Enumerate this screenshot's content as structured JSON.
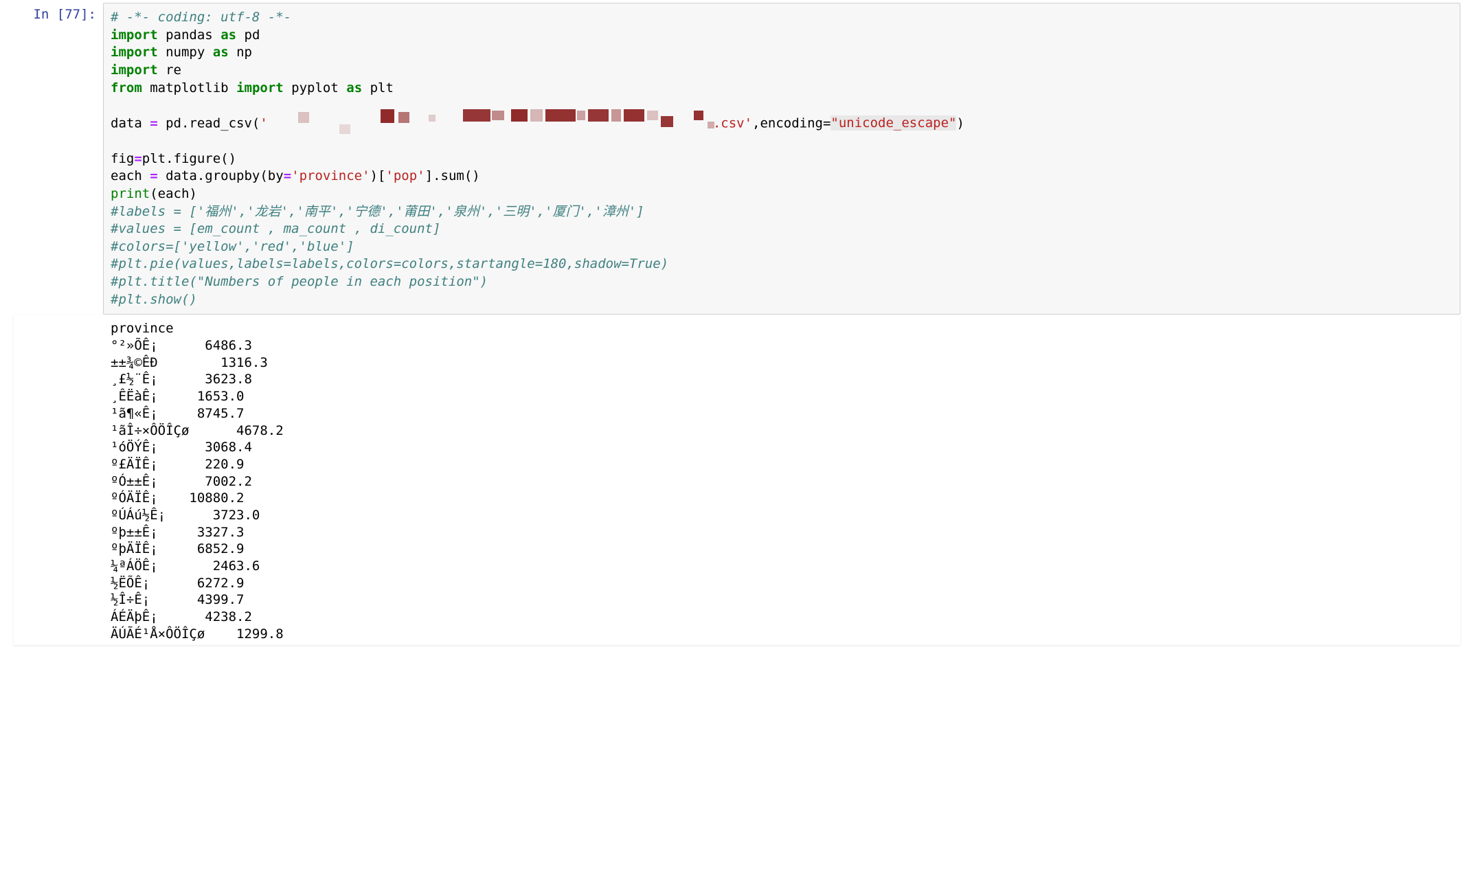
{
  "prompt": "In [77]:",
  "code": {
    "line1_comment": "# -*- coding: utf-8 -*-",
    "import_kw": "import",
    "from_kw": "from",
    "as_kw": "as",
    "pandas": "pandas",
    "pd": "pd",
    "numpy": "numpy",
    "np": "np",
    "re": "re",
    "matplotlib": "matplotlib",
    "pyplot": "pyplot",
    "plt": "plt",
    "data_var": "data ",
    "eq": "=",
    "readcsv_call": " pd.read_csv(",
    "str_start": "'",
    "csv_tail": ".csv'",
    "encoding_arg": ",encoding=",
    "encoding_val": "\"unicode_escape\"",
    "close_paren": ")",
    "fig_line_a": "fig",
    "fig_line_b": "plt.figure()",
    "each_line_a": "each ",
    "each_line_b": " data.groupby(by",
    "each_line_eq2": "=",
    "str_province": "'province'",
    "each_line_c": ")[",
    "str_pop": "'pop'",
    "each_line_d": "].sum()",
    "print_name": "print",
    "print_arg": "(each)",
    "c_labels": "#labels = ['福州','龙岩','南平','宁德','莆田','泉州','三明','厦门','漳州']",
    "c_values": "#values = [em_count , ma_count , di_count]",
    "c_colors": "#colors=['yellow','red','blue']",
    "c_pie": "#plt.pie(values,labels=labels,colors=colors,startangle=180,shadow=True)",
    "c_title": "#plt.title(\"Numbers of people in each position\")",
    "c_show": "#plt.show()"
  },
  "output": {
    "header": "province",
    "rows": [
      {
        "label": "°²»ÕÊ¡",
        "spacer": "      ",
        "value": "6486.3"
      },
      {
        "label": "±±¾©ÊÐ",
        "spacer": "        ",
        "value": "1316.3"
      },
      {
        "label": "¸£½¨Ê¡",
        "spacer": "      ",
        "value": "3623.8"
      },
      {
        "label": "¸ÊËàÊ¡",
        "spacer": "     ",
        "value": "1653.0"
      },
      {
        "label": "¹ã¶«Ê¡",
        "spacer": "     ",
        "value": "8745.7"
      },
      {
        "label": "¹ãÎ÷×ÔÖÎÇø",
        "spacer": "      ",
        "value": "4678.2"
      },
      {
        "label": "¹óÖÝÊ¡",
        "spacer": "      ",
        "value": "3068.4"
      },
      {
        "label": "º£ÄÏÊ¡",
        "spacer": "      ",
        "value": "220.9"
      },
      {
        "label": "ºÓ±±Ê¡",
        "spacer": "      ",
        "value": "7002.2"
      },
      {
        "label": "ºÓÄÏÊ¡",
        "spacer": "    ",
        "value": "10880.2"
      },
      {
        "label": "ºÚÁú½Ê¡",
        "spacer": "      ",
        "value": "3723.0"
      },
      {
        "label": "ºþ±±Ê¡",
        "spacer": "     ",
        "value": "3327.3"
      },
      {
        "label": "ºþÄÏÊ¡",
        "spacer": "     ",
        "value": "6852.9"
      },
      {
        "label": "¼ªÁÖÊ¡",
        "spacer": "       ",
        "value": "2463.6"
      },
      {
        "label": "½ËÕÊ¡",
        "spacer": "      ",
        "value": "6272.9"
      },
      {
        "label": "½Î÷Ê¡",
        "spacer": "      ",
        "value": "4399.7"
      },
      {
        "label": "ÁÉÄþÊ¡",
        "spacer": "      ",
        "value": "4238.2"
      },
      {
        "label": "ÄÚÃÉ¹Å×ÔÖÎÇø",
        "spacer": "    ",
        "value": "1299.8"
      }
    ]
  }
}
